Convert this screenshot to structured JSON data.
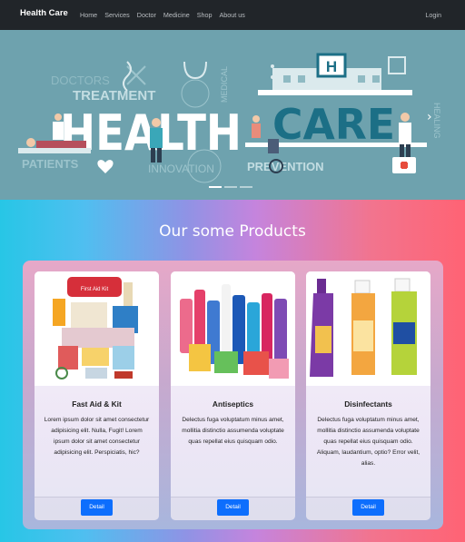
{
  "navbar": {
    "brand": "Health Care",
    "links": [
      "Home",
      "Services",
      "Doctor",
      "Medicine",
      "Shop",
      "About us"
    ],
    "login": "Login"
  },
  "hero": {
    "heading_word_1": "HEALTH",
    "heading_word_2": "CARE",
    "words": [
      "DOCTORS",
      "TREATMENT",
      "PATIENTS",
      "INNOVATION",
      "PREVENTION",
      "MEDICAL",
      "HEALING"
    ],
    "sign_letter": "H",
    "prev_icon": "chevron-left-icon",
    "next_icon": "chevron-right-icon",
    "next_glyph": "›",
    "slide_count": 3,
    "active_slide": 1
  },
  "products": {
    "title": "Our some Products",
    "cards": [
      {
        "title": "Fast Aid & Kit",
        "text": "Lorem ipsum dolor sit amet consectetur adipisicing elit. Nulla, Fugit! Lorem ipsum dolor sit amet consectetur adipisicing elit. Perspiciatis, hic?",
        "button": "Detail",
        "image_icon": "first-aid-kit-image",
        "image_label": "First Aid Kit"
      },
      {
        "title": "Antiseptics",
        "text": "Delectus fuga voluptatum minus amet, mollitia distinctio assumenda voluptate quas repellat eius quisquam odio.",
        "button": "Detail",
        "image_icon": "antiseptic-bottles-image"
      },
      {
        "title": "Disinfectants",
        "text": "Delectus fuga voluptatum minus amet, mollitia distinctio assumenda voluptate quas repellat eius quisquam odio. Aliquam, laudantium, optio? Error velit, alias.",
        "button": "Detail",
        "image_icon": "disinfectant-bottles-image"
      }
    ]
  },
  "colors": {
    "navbar_bg": "#212529",
    "hero_bg": "#6ea2ae",
    "button_bg": "#0d6efd",
    "gradient_start": "#27c6e6",
    "gradient_end": "#ff6374"
  }
}
